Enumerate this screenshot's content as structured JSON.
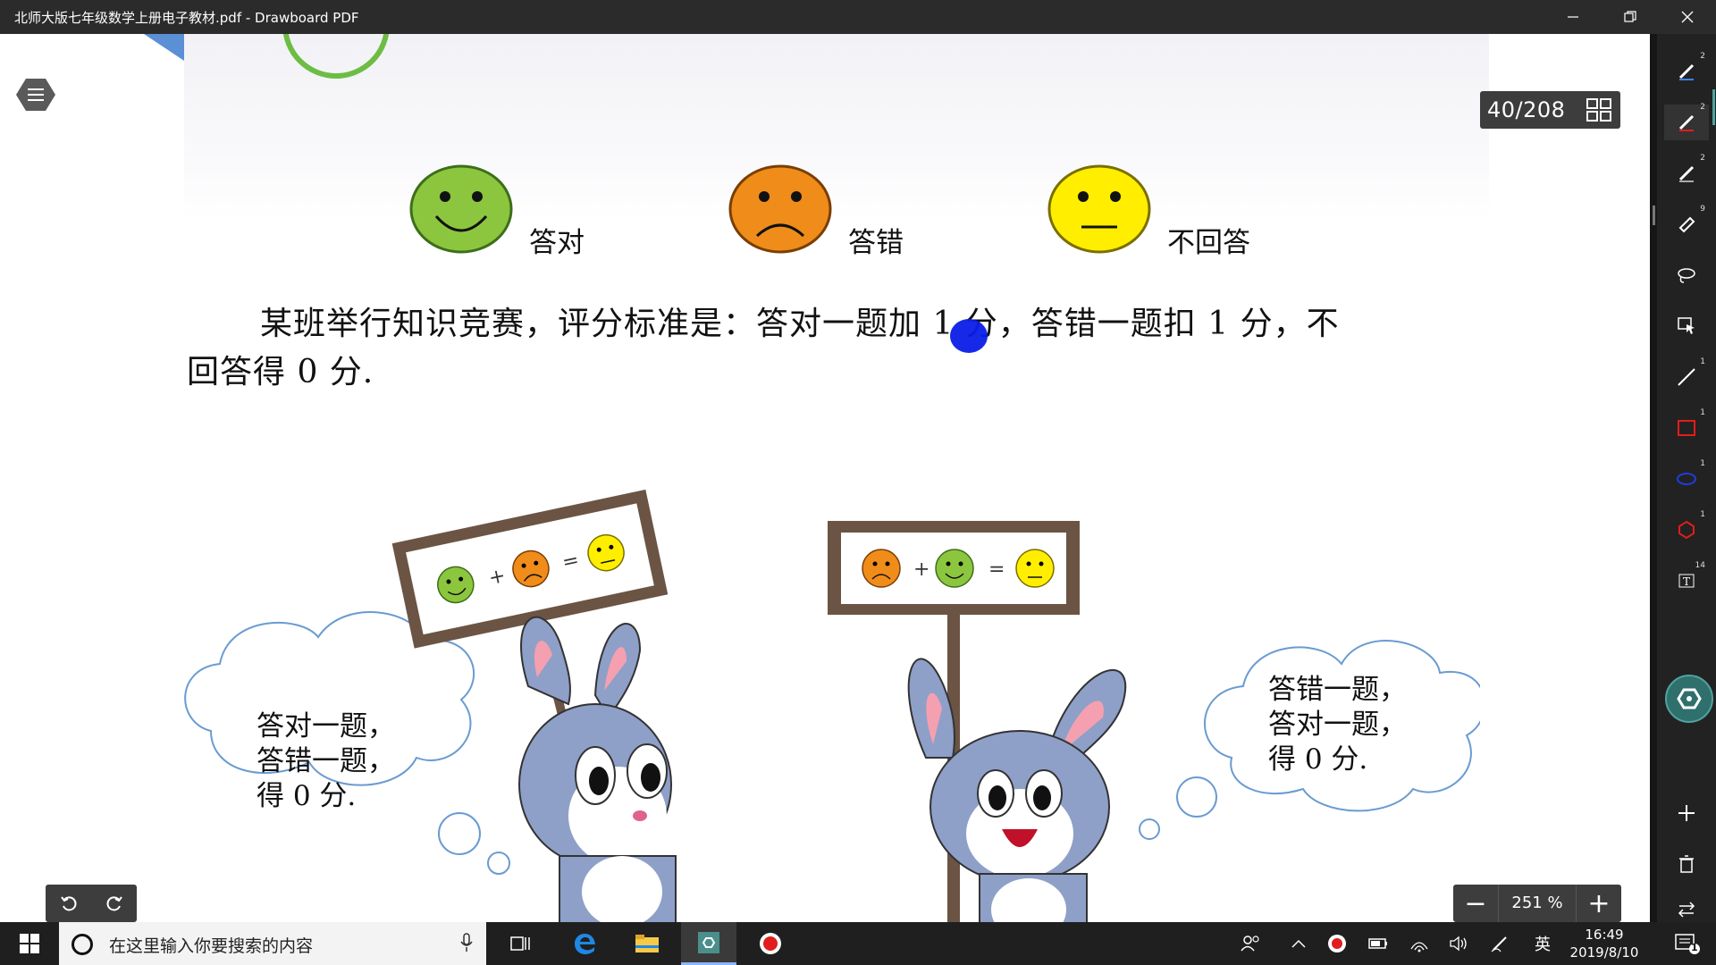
{
  "window": {
    "title": "北师大版七年级数学上册电子教材.pdf - Drawboard PDF",
    "minimize_icon": "minimize-icon",
    "restore_icon": "restore-icon",
    "close_icon": "close-icon"
  },
  "viewer": {
    "page_counter": "40/208",
    "zoom": "251 %",
    "zoom_minus": "−",
    "zoom_plus": "+"
  },
  "document": {
    "faces": [
      {
        "label": "答对",
        "expression": "smile",
        "color": "#8cc63e"
      },
      {
        "label": "答错",
        "expression": "frown",
        "color": "#f08c1a"
      },
      {
        "label": "不回答",
        "expression": "neutral",
        "color": "#ffee00"
      }
    ],
    "problem_line1": "某班举行知识竞赛，评分标准是：答对一题加 1 分，答错一题扣 1 分，不",
    "problem_line2": "回答得 0 分.",
    "left_bubble": "答对一题，\n答错一题，\n得 0 分.",
    "right_bubble": "答错一题，\n答对一题，\n得 0 分.",
    "sign_plus": "+",
    "sign_equals": "="
  },
  "toolbar": {
    "tools": [
      {
        "name": "pen-tool-blue",
        "badge": "2"
      },
      {
        "name": "pen-tool-red",
        "badge": "2"
      },
      {
        "name": "pen-tool-gray",
        "badge": "2"
      },
      {
        "name": "highlighter-tool",
        "badge": "9"
      },
      {
        "name": "lasso-tool",
        "badge": ""
      },
      {
        "name": "select-tool",
        "badge": ""
      },
      {
        "name": "line-tool",
        "badge": "1"
      },
      {
        "name": "rectangle-tool",
        "badge": "1"
      },
      {
        "name": "ellipse-tool",
        "badge": "1"
      },
      {
        "name": "polygon-tool",
        "badge": "1"
      },
      {
        "name": "text-tool",
        "badge": "14"
      }
    ]
  },
  "taskbar": {
    "search_placeholder": "在这里输入你要搜索的内容",
    "ime": "英",
    "time": "16:49",
    "date": "2019/8/10",
    "notification_count": "1"
  },
  "colors": {
    "titlebar_bg": "#2b2b2b",
    "toolbar_bg": "#222222",
    "taskbar_bg": "#1f1f1f",
    "bunny_gray": "#8ea0c8",
    "sign_wood": "#6b5444",
    "cursor_dot": "#0a1ee8"
  }
}
